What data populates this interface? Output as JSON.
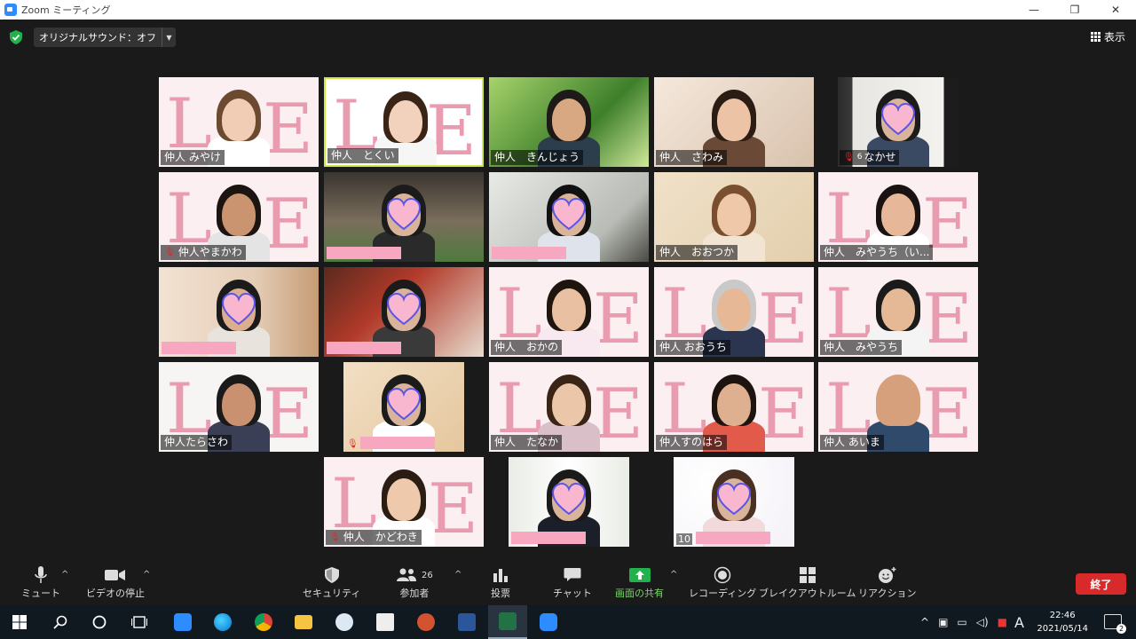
{
  "window": {
    "title": "Zoom ミーティング",
    "minimize": "—",
    "restore": "❐",
    "close": "✕"
  },
  "topbar": {
    "audio_label": "オリジナルサウンド：オフ",
    "view_label": "表示"
  },
  "tiles": [
    {
      "name": "仲人 みやけ",
      "muted": false
    },
    {
      "name": "仲人　とくい",
      "muted": false,
      "speaking": true
    },
    {
      "name": "仲人　きんじょう",
      "muted": false
    },
    {
      "name": "仲人　さわみ",
      "muted": false
    },
    {
      "name": "なかせ",
      "muted": true,
      "prefix": "6"
    },
    {
      "name": "仲人やまかわ",
      "muted": true
    },
    {
      "name": "",
      "muted": false
    },
    {
      "name": "",
      "muted": false
    },
    {
      "name": "仲人　おおつか",
      "muted": false
    },
    {
      "name": "仲人　みやうち（い...",
      "muted": false
    },
    {
      "name": "",
      "muted": false
    },
    {
      "name": "",
      "muted": false
    },
    {
      "name": "仲人　おかの",
      "muted": false
    },
    {
      "name": "仲人 おおうち",
      "muted": false
    },
    {
      "name": "仲人　みやうち",
      "muted": false
    },
    {
      "name": "仲人たらさわ",
      "muted": false
    },
    {
      "name": "",
      "muted": true
    },
    {
      "name": "仲人　たなか",
      "muted": false
    },
    {
      "name": "仲人すのはら",
      "muted": false
    },
    {
      "name": "仲人 あいま",
      "muted": false
    },
    {
      "name": "仲人　かどわき",
      "muted": true
    },
    {
      "name": "",
      "muted": false
    },
    {
      "name": "",
      "muted": false,
      "prefix": "10"
    }
  ],
  "toolbar": {
    "mute": "ミュート",
    "video": "ビデオの停止",
    "security": "セキュリティ",
    "participants": "参加者",
    "participants_count": "26",
    "polls": "投票",
    "chat": "チャット",
    "share": "画面の共有",
    "record": "レコーディング",
    "breakout": "ブレイクアウトルーム",
    "reactions": "リアクション",
    "end": "終了"
  },
  "taskbar": {
    "time": "22:46",
    "date": "2021/05/14",
    "notifications": "2",
    "ime": "A"
  },
  "colors": {
    "accent_green": "#7cd36d",
    "end_red": "#d82a2a",
    "speaker_border": "#c9e84a",
    "placeholder_pink": "#f7a8c0"
  }
}
